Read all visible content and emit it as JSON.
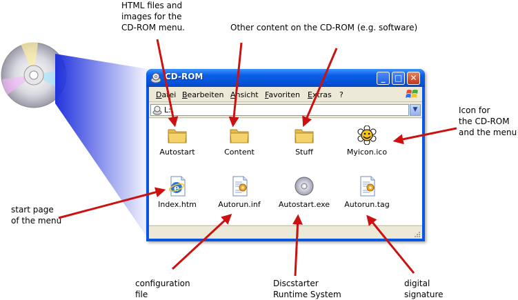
{
  "window": {
    "title": "CD-ROM",
    "minimize_glyph": "_",
    "maximize_glyph": "□",
    "close_glyph": "✕"
  },
  "menu": [
    "Datei",
    "Bearbeiten",
    "Ansicht",
    "Favoriten",
    "Extras",
    "?"
  ],
  "address": {
    "value": "L:\\"
  },
  "files": [
    {
      "name": "Autostart",
      "icon": "folder-icon"
    },
    {
      "name": "Content",
      "icon": "folder-icon"
    },
    {
      "name": "Stuff",
      "icon": "folder-icon"
    },
    {
      "name": "Myicon.ico",
      "icon": "flower-smiley-icon"
    },
    {
      "name": "Index.htm",
      "icon": "html-document-icon"
    },
    {
      "name": "Autorun.inf",
      "icon": "settings-file-icon"
    },
    {
      "name": "Autostart.exe",
      "icon": "cd-application-icon"
    },
    {
      "name": "Autorun.tag",
      "icon": "settings-file-icon"
    }
  ],
  "annotations": {
    "html_files": [
      "HTML files and",
      "images for the",
      "CD-ROM menu."
    ],
    "other_content": [
      "Other content on the CD-ROM (e.g. software)"
    ],
    "icon_for_cd": [
      "Icon for",
      "the CD-ROM",
      "and the menu"
    ],
    "start_page": [
      "start page",
      "of the menu"
    ],
    "configuration": [
      "configuration",
      "file"
    ],
    "runtime": [
      "Discstarter",
      "Runtime System"
    ],
    "signature": [
      "digital",
      "signature"
    ]
  },
  "colors": {
    "arrow": "#cc1111",
    "beam": "#2233dd",
    "titlebar": "#0a5fe6",
    "folder": "#f5d36b"
  }
}
